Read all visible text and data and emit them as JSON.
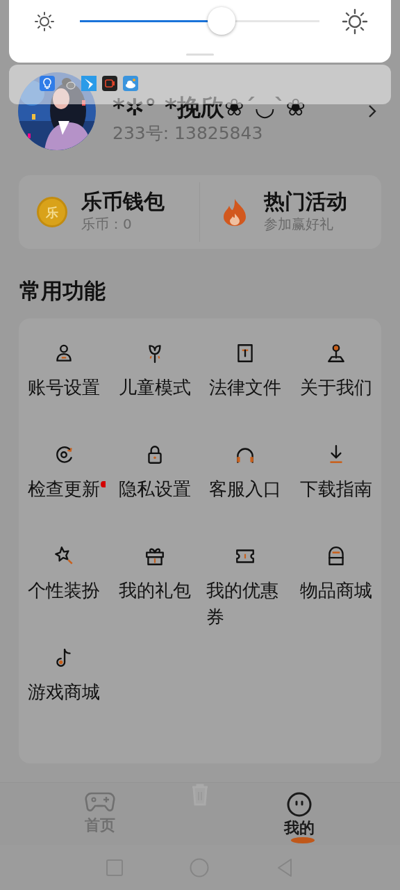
{
  "brightness": {
    "level": 0.59
  },
  "profile": {
    "name": "*✲° *挽欣❀´◡`❀",
    "id": "233号: 13825843"
  },
  "wallet": [
    {
      "kind": "coin",
      "coin_symbol": "乐",
      "title": "乐币钱包",
      "subtitle": "乐币：0"
    },
    {
      "kind": "fire",
      "title": "热门活动",
      "subtitle": "参加赢好礼"
    }
  ],
  "section_title": "常用功能",
  "features": [
    {
      "label": "账号设置",
      "dot": false
    },
    {
      "label": "儿童模式",
      "dot": false
    },
    {
      "label": "法律文件",
      "dot": false
    },
    {
      "label": "关于我们",
      "dot": false
    },
    {
      "label": "检查更新",
      "dot": true
    },
    {
      "label": "隐私设置",
      "dot": false
    },
    {
      "label": "客服入口",
      "dot": false
    },
    {
      "label": "下载指南",
      "dot": false
    },
    {
      "label": "个性装扮",
      "dot": false
    },
    {
      "label": "我的礼包",
      "dot": false
    },
    {
      "label": "我的优惠券",
      "dot": false
    },
    {
      "label": "物品商城",
      "dot": false
    },
    {
      "label": "游戏商城",
      "dot": false
    }
  ],
  "bottom_nav": [
    {
      "label": "首页",
      "selected": false
    },
    {
      "label": "我的",
      "selected": true
    }
  ]
}
